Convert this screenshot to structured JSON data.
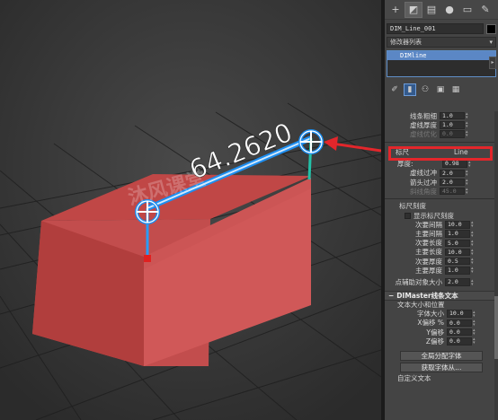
{
  "viewport": {
    "dimension_label": "64.2620",
    "watermark": "沐风课堂"
  },
  "command_panel": {
    "toolbar_icons": [
      "create-icon",
      "modify-icon",
      "hierarchy-icon",
      "motion-icon",
      "display-icon",
      "utilities-icon"
    ],
    "object_name": "DIM_Line_001",
    "object_color": "#000000",
    "modifier_list_label": "修改器列表",
    "stack_items": [
      "DIMline"
    ],
    "stack_tools": [
      "pin-icon",
      "show-end-result-icon",
      "make-unique-icon",
      "remove-modifier-icon",
      "configure-icon"
    ],
    "line_params": [
      {
        "label": "线条粗细",
        "value": "1.0",
        "dim": false
      },
      {
        "label": "虚线厚度",
        "value": "1.0",
        "dim": false
      },
      {
        "label": "虚线优化",
        "value": "0.0",
        "dim": true
      }
    ],
    "highlight_label": "标尺",
    "highlight_label_tail": "Line",
    "thickness_label": "厚度:",
    "thickness_value": "0.98",
    "offset_params": [
      {
        "label": "虚线过冲",
        "value": "2.0",
        "dim": false
      },
      {
        "label": "箭头过冲",
        "value": "2.0",
        "dim": false
      },
      {
        "label": "斜线角度",
        "value": "45.0",
        "dim": true
      }
    ],
    "ruler_group_label": "标尺刻度",
    "show_ruler_label": "显示标尺刻度",
    "ruler_params": [
      {
        "label": "次要间隔",
        "value": "10.0"
      },
      {
        "label": "主要间隔",
        "value": "1.0"
      },
      {
        "label": "次要长度",
        "value": "5.0"
      },
      {
        "label": "主要长度",
        "value": "10.0"
      },
      {
        "label": "次要厚度",
        "value": "0.5"
      },
      {
        "label": "主要厚度",
        "value": "1.0"
      }
    ],
    "aux_param": {
      "label": "点辅助对象大小",
      "value": "2.0"
    },
    "text_section_title": "DIMaster线条文本",
    "text_group_label": "文本大小和位置",
    "text_params": [
      {
        "label": "字体大小",
        "value": "10.0"
      },
      {
        "label": "X偏移 %",
        "value": "0.0"
      },
      {
        "label": "Y偏移",
        "value": "0.0"
      },
      {
        "label": "Z偏移",
        "value": "0.0"
      }
    ],
    "btn_assign_font": "全局分配字体",
    "btn_get_font": "获取字体从...",
    "custom_text_label": "自定义文本"
  },
  "annotation": {
    "highlight_color": "#e3262b"
  }
}
